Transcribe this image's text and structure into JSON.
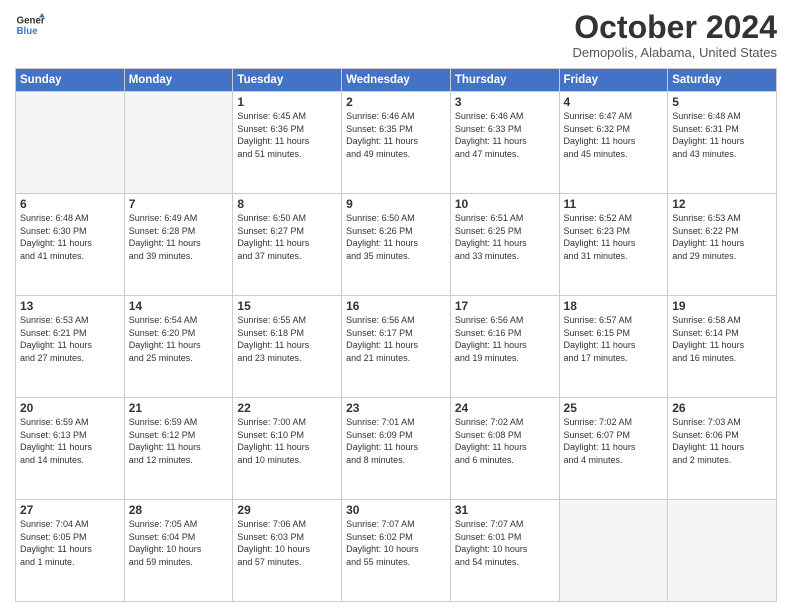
{
  "header": {
    "logo_line1": "General",
    "logo_line2": "Blue",
    "month_title": "October 2024",
    "location": "Demopolis, Alabama, United States"
  },
  "weekdays": [
    "Sunday",
    "Monday",
    "Tuesday",
    "Wednesday",
    "Thursday",
    "Friday",
    "Saturday"
  ],
  "weeks": [
    [
      {
        "day": "",
        "info": ""
      },
      {
        "day": "",
        "info": ""
      },
      {
        "day": "1",
        "info": "Sunrise: 6:45 AM\nSunset: 6:36 PM\nDaylight: 11 hours\nand 51 minutes."
      },
      {
        "day": "2",
        "info": "Sunrise: 6:46 AM\nSunset: 6:35 PM\nDaylight: 11 hours\nand 49 minutes."
      },
      {
        "day": "3",
        "info": "Sunrise: 6:46 AM\nSunset: 6:33 PM\nDaylight: 11 hours\nand 47 minutes."
      },
      {
        "day": "4",
        "info": "Sunrise: 6:47 AM\nSunset: 6:32 PM\nDaylight: 11 hours\nand 45 minutes."
      },
      {
        "day": "5",
        "info": "Sunrise: 6:48 AM\nSunset: 6:31 PM\nDaylight: 11 hours\nand 43 minutes."
      }
    ],
    [
      {
        "day": "6",
        "info": "Sunrise: 6:48 AM\nSunset: 6:30 PM\nDaylight: 11 hours\nand 41 minutes."
      },
      {
        "day": "7",
        "info": "Sunrise: 6:49 AM\nSunset: 6:28 PM\nDaylight: 11 hours\nand 39 minutes."
      },
      {
        "day": "8",
        "info": "Sunrise: 6:50 AM\nSunset: 6:27 PM\nDaylight: 11 hours\nand 37 minutes."
      },
      {
        "day": "9",
        "info": "Sunrise: 6:50 AM\nSunset: 6:26 PM\nDaylight: 11 hours\nand 35 minutes."
      },
      {
        "day": "10",
        "info": "Sunrise: 6:51 AM\nSunset: 6:25 PM\nDaylight: 11 hours\nand 33 minutes."
      },
      {
        "day": "11",
        "info": "Sunrise: 6:52 AM\nSunset: 6:23 PM\nDaylight: 11 hours\nand 31 minutes."
      },
      {
        "day": "12",
        "info": "Sunrise: 6:53 AM\nSunset: 6:22 PM\nDaylight: 11 hours\nand 29 minutes."
      }
    ],
    [
      {
        "day": "13",
        "info": "Sunrise: 6:53 AM\nSunset: 6:21 PM\nDaylight: 11 hours\nand 27 minutes."
      },
      {
        "day": "14",
        "info": "Sunrise: 6:54 AM\nSunset: 6:20 PM\nDaylight: 11 hours\nand 25 minutes."
      },
      {
        "day": "15",
        "info": "Sunrise: 6:55 AM\nSunset: 6:18 PM\nDaylight: 11 hours\nand 23 minutes."
      },
      {
        "day": "16",
        "info": "Sunrise: 6:56 AM\nSunset: 6:17 PM\nDaylight: 11 hours\nand 21 minutes."
      },
      {
        "day": "17",
        "info": "Sunrise: 6:56 AM\nSunset: 6:16 PM\nDaylight: 11 hours\nand 19 minutes."
      },
      {
        "day": "18",
        "info": "Sunrise: 6:57 AM\nSunset: 6:15 PM\nDaylight: 11 hours\nand 17 minutes."
      },
      {
        "day": "19",
        "info": "Sunrise: 6:58 AM\nSunset: 6:14 PM\nDaylight: 11 hours\nand 16 minutes."
      }
    ],
    [
      {
        "day": "20",
        "info": "Sunrise: 6:59 AM\nSunset: 6:13 PM\nDaylight: 11 hours\nand 14 minutes."
      },
      {
        "day": "21",
        "info": "Sunrise: 6:59 AM\nSunset: 6:12 PM\nDaylight: 11 hours\nand 12 minutes."
      },
      {
        "day": "22",
        "info": "Sunrise: 7:00 AM\nSunset: 6:10 PM\nDaylight: 11 hours\nand 10 minutes."
      },
      {
        "day": "23",
        "info": "Sunrise: 7:01 AM\nSunset: 6:09 PM\nDaylight: 11 hours\nand 8 minutes."
      },
      {
        "day": "24",
        "info": "Sunrise: 7:02 AM\nSunset: 6:08 PM\nDaylight: 11 hours\nand 6 minutes."
      },
      {
        "day": "25",
        "info": "Sunrise: 7:02 AM\nSunset: 6:07 PM\nDaylight: 11 hours\nand 4 minutes."
      },
      {
        "day": "26",
        "info": "Sunrise: 7:03 AM\nSunset: 6:06 PM\nDaylight: 11 hours\nand 2 minutes."
      }
    ],
    [
      {
        "day": "27",
        "info": "Sunrise: 7:04 AM\nSunset: 6:05 PM\nDaylight: 11 hours\nand 1 minute."
      },
      {
        "day": "28",
        "info": "Sunrise: 7:05 AM\nSunset: 6:04 PM\nDaylight: 10 hours\nand 59 minutes."
      },
      {
        "day": "29",
        "info": "Sunrise: 7:06 AM\nSunset: 6:03 PM\nDaylight: 10 hours\nand 57 minutes."
      },
      {
        "day": "30",
        "info": "Sunrise: 7:07 AM\nSunset: 6:02 PM\nDaylight: 10 hours\nand 55 minutes."
      },
      {
        "day": "31",
        "info": "Sunrise: 7:07 AM\nSunset: 6:01 PM\nDaylight: 10 hours\nand 54 minutes."
      },
      {
        "day": "",
        "info": ""
      },
      {
        "day": "",
        "info": ""
      }
    ]
  ]
}
